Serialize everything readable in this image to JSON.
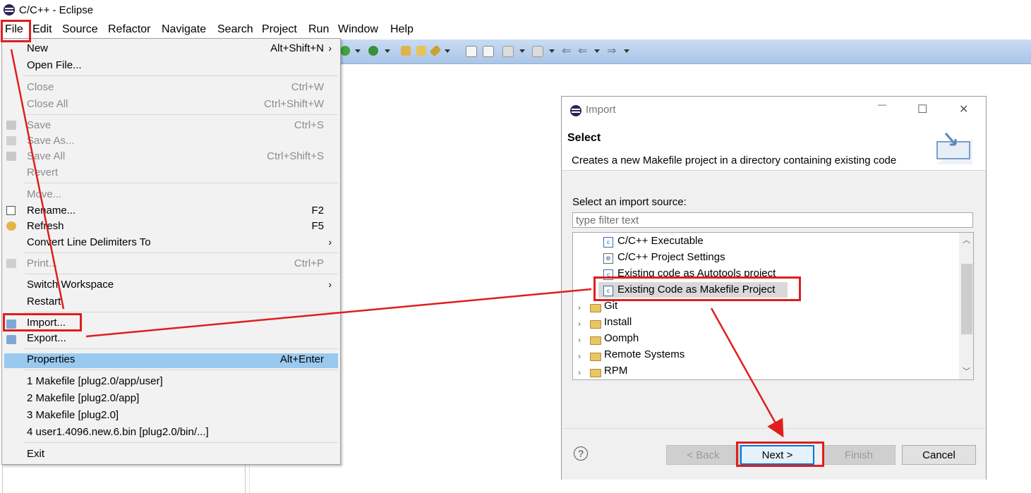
{
  "window": {
    "title": "C/C++ - Eclipse"
  },
  "menubar": [
    "File",
    "Edit",
    "Source",
    "Refactor",
    "Navigate",
    "Search",
    "Project",
    "Run",
    "Window",
    "Help"
  ],
  "file_menu": {
    "new": {
      "label": "New",
      "shortcut": "Alt+Shift+N"
    },
    "open_file": {
      "label": "Open File..."
    },
    "close": {
      "label": "Close",
      "shortcut": "Ctrl+W"
    },
    "close_all": {
      "label": "Close All",
      "shortcut": "Ctrl+Shift+W"
    },
    "save": {
      "label": "Save",
      "shortcut": "Ctrl+S"
    },
    "save_as": {
      "label": "Save As..."
    },
    "save_all": {
      "label": "Save All",
      "shortcut": "Ctrl+Shift+S"
    },
    "revert": {
      "label": "Revert"
    },
    "move": {
      "label": "Move..."
    },
    "rename": {
      "label": "Rename...",
      "shortcut": "F2"
    },
    "refresh": {
      "label": "Refresh",
      "shortcut": "F5"
    },
    "convert": {
      "label": "Convert Line Delimiters To"
    },
    "print": {
      "label": "Print...",
      "shortcut": "Ctrl+P"
    },
    "switch_workspace": {
      "label": "Switch Workspace"
    },
    "restart": {
      "label": "Restart"
    },
    "import": {
      "label": "Import..."
    },
    "export": {
      "label": "Export..."
    },
    "properties": {
      "label": "Properties",
      "shortcut": "Alt+Enter"
    },
    "recent": [
      "1 Makefile  [plug2.0/app/user]",
      "2 Makefile  [plug2.0/app]",
      "3 Makefile  [plug2.0]",
      "4 user1.4096.new.6.bin  [plug2.0/bin/...]"
    ],
    "exit": {
      "label": "Exit"
    }
  },
  "dialog": {
    "title": "Import",
    "heading": "Select",
    "description": "Creates a new Makefile project in a directory containing existing code",
    "source_label": "Select an import source:",
    "filter_placeholder": "type filter text",
    "tree": [
      {
        "label": "C/C++ Executable"
      },
      {
        "label": "C/C++ Project Settings"
      },
      {
        "label": "Existing code as Autotools project"
      },
      {
        "label": "Existing Code as Makefile Project"
      },
      {
        "label": "Git"
      },
      {
        "label": "Install"
      },
      {
        "label": "Oomph"
      },
      {
        "label": "Remote Systems"
      },
      {
        "label": "RPM"
      }
    ],
    "buttons": {
      "back": "< Back",
      "next": "Next >",
      "finish": "Finish",
      "cancel": "Cancel"
    }
  },
  "colors": {
    "highlight": "#99c9ef",
    "annotation_red": "#e11d1d",
    "toolbar": "#b9d1ee"
  }
}
